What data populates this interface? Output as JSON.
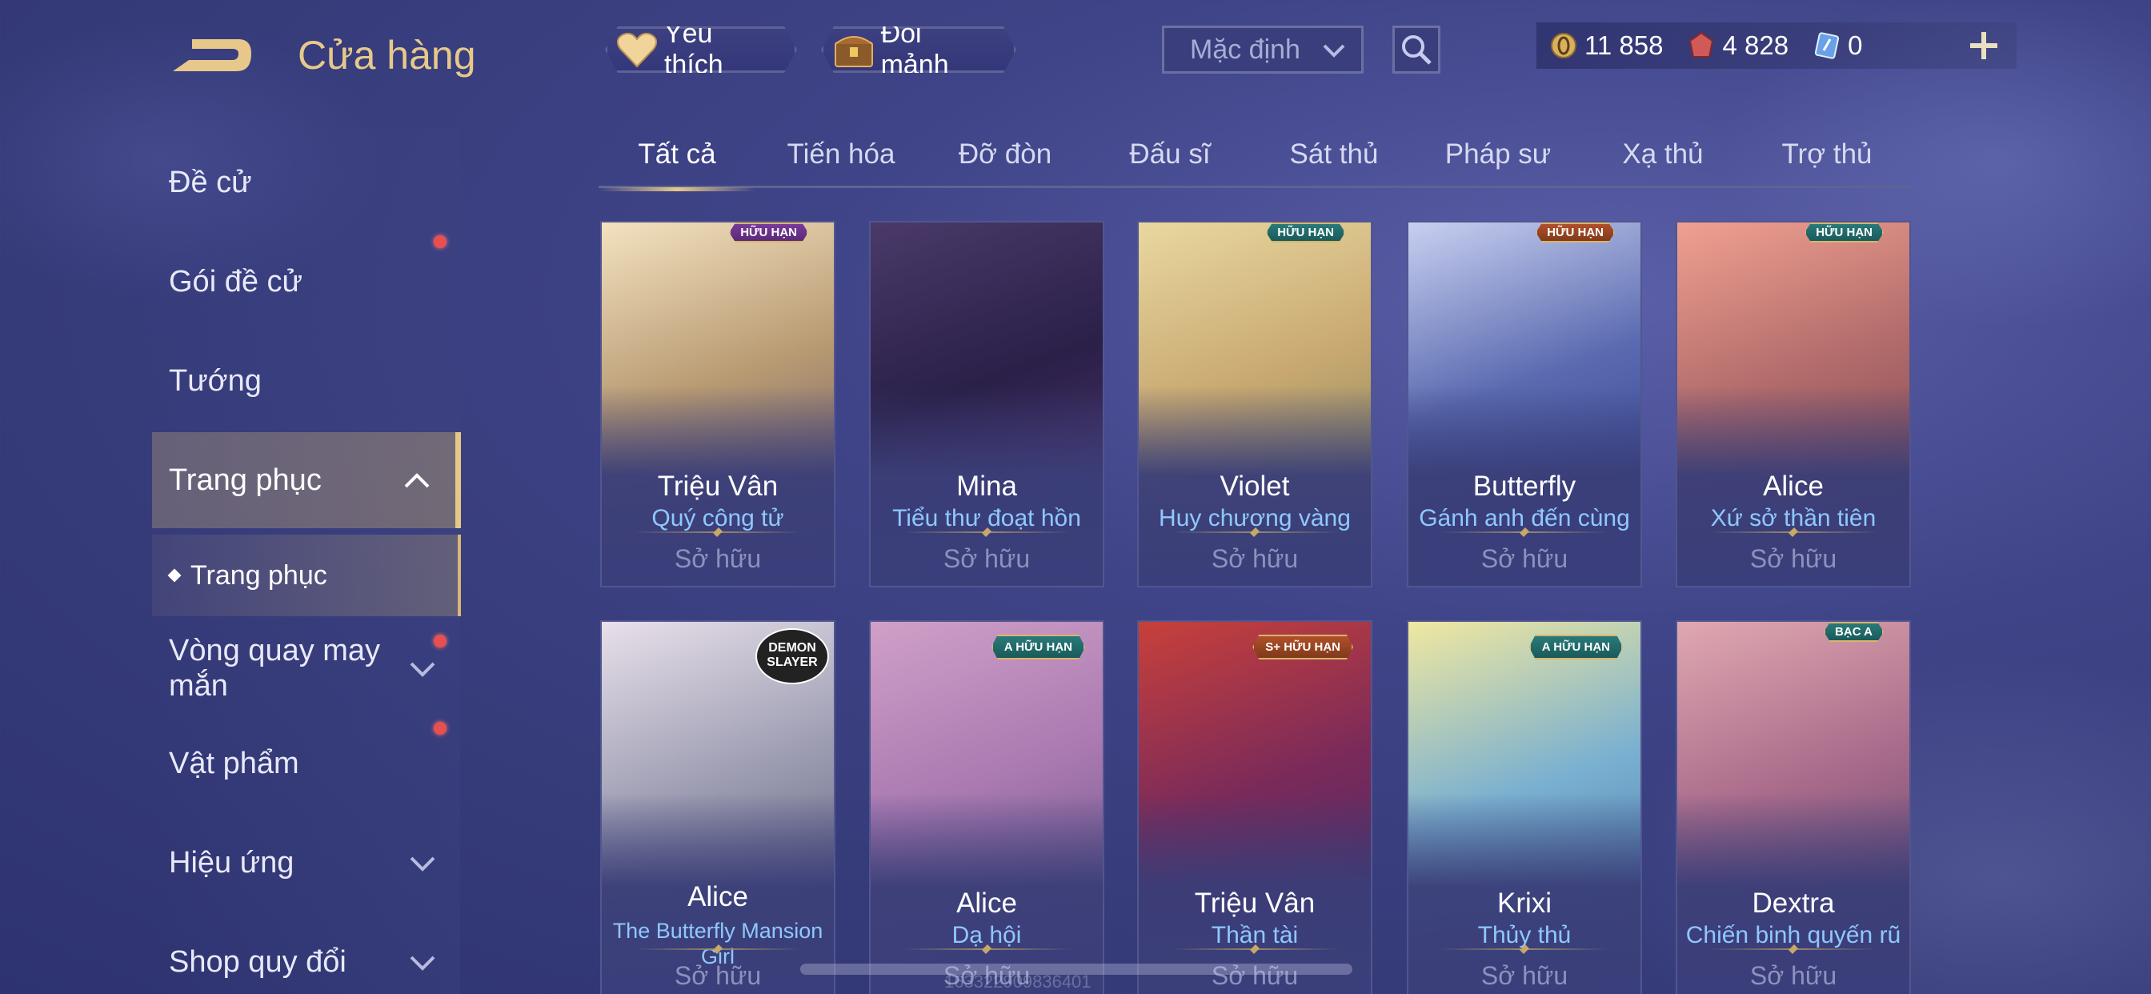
{
  "header": {
    "title": "Cửa hàng",
    "favorite_label": "Yêu thích",
    "fragment_label": "Đổi mảnh",
    "sort_value": "Mặc định",
    "currencies": [
      {
        "icon": "gold-coin-icon",
        "value": "11 858"
      },
      {
        "icon": "red-gem-icon",
        "value": "4 828"
      },
      {
        "icon": "blue-voucher-icon",
        "value": "0"
      }
    ]
  },
  "sidebar": {
    "items": [
      {
        "label": "Đề cử"
      },
      {
        "label": "Gói đề cử"
      },
      {
        "label": "Tướng"
      },
      {
        "label": "Trang phục"
      },
      {
        "label": "Vòng quay may mắn"
      },
      {
        "label": "Vật phẩm"
      },
      {
        "label": "Hiệu ứng"
      },
      {
        "label": "Shop quy đổi"
      }
    ],
    "sub_item": "Trang phục"
  },
  "tabs": [
    "Tất cả",
    "Tiến hóa",
    "Đỡ đòn",
    "Đấu sĩ",
    "Sát thủ",
    "Pháp sư",
    "Xạ thủ",
    "Trợ thủ"
  ],
  "cards": [
    {
      "hero": "Triệu Vân",
      "skin": "Quý công tử",
      "status": "Sở hữu",
      "badge": "HỮU HẠN",
      "badge_color": "purple",
      "colors": [
        "#f3e2c0",
        "#b89a72",
        "#5a4a6a"
      ]
    },
    {
      "hero": "Mina",
      "skin": "Tiểu thư đoạt hồn",
      "status": "Sở hữu",
      "badge": "",
      "badge_color": "",
      "colors": [
        "#4a3a6a",
        "#2a2048",
        "#5a3a7a"
      ]
    },
    {
      "hero": "Violet",
      "skin": "Huy chương vàng",
      "status": "Sở hữu",
      "badge": "HỮU HẠN",
      "badge_color": "teal",
      "colors": [
        "#e8d8a0",
        "#c8a870",
        "#6a7a5a"
      ]
    },
    {
      "hero": "Butterfly",
      "skin": "Gánh anh đến cùng",
      "status": "Sở hữu",
      "badge": "HỮU HẠN",
      "badge_color": "orange",
      "colors": [
        "#c8d0f0",
        "#5a6ab0",
        "#2a3a8a"
      ]
    },
    {
      "hero": "Alice",
      "skin": "Xứ sở thần tiên",
      "status": "Sở hữu",
      "badge": "HỮU HẠN",
      "badge_color": "teal",
      "colors": [
        "#f0a090",
        "#b06a6a",
        "#6a3a4a"
      ]
    },
    {
      "hero": "Alice",
      "skin": "The Butterfly Mansion Girl",
      "status": "Sở hữu",
      "badge": "DEMON SLAYER",
      "badge_color": "demon",
      "colors": [
        "#e8e0ea",
        "#9a9ab0",
        "#4a4a6a"
      ]
    },
    {
      "hero": "Alice",
      "skin": "Dạ hội",
      "status": "Sở hữu",
      "badge": "A HỮU HẠN",
      "badge_color": "teal",
      "colors": [
        "#d0a0c8",
        "#a878b0",
        "#5a4a7a"
      ]
    },
    {
      "hero": "Triệu Vân",
      "skin": "Thần tài",
      "status": "Sở hữu",
      "badge": "S+ HỮU HẠN",
      "badge_color": "orange",
      "colors": [
        "#c8403a",
        "#7a2a5a",
        "#3a2a6a"
      ]
    },
    {
      "hero": "Krixi",
      "skin": "Thủy thủ",
      "status": "Sở hữu",
      "badge": "A HỮU HẠN",
      "badge_color": "teal",
      "colors": [
        "#f0e8a0",
        "#7ab0d0",
        "#3a6aa0"
      ]
    },
    {
      "hero": "Dextra",
      "skin": "Chiến binh quyến rũ",
      "status": "Sở hữu",
      "badge": "BẠC A",
      "badge_color": "teal",
      "colors": [
        "#e0a8b0",
        "#a86a8a",
        "#4a3a6a"
      ]
    }
  ],
  "footer_id": "163322909836401"
}
